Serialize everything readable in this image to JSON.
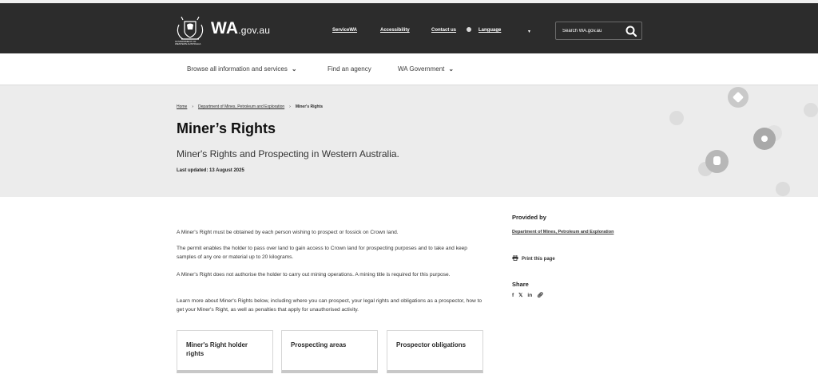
{
  "header": {
    "logo_main": "WA",
    "logo_domain": ".gov.au",
    "crest_caption": "GOVERNMENT OF WESTERN AUSTRALIA",
    "links": [
      "ServiceWA",
      "Accessibility",
      "Contact us"
    ],
    "language_label": "Language",
    "search_placeholder": "Search WA.gov.au"
  },
  "nav": {
    "items": [
      "Browse all information and services",
      "Find an agency",
      "WA Government"
    ]
  },
  "hero": {
    "breadcrumb": [
      "Home",
      "Department of Mines, Petroleum and Exploration",
      "Miner's Rights"
    ],
    "title": "Miner’s Rights",
    "subtitle": "Miner's Rights and Prospecting in Western Australia.",
    "last_updated": "Last updated: 13 August 2025"
  },
  "main": {
    "paragraphs": [
      "A Miner's Right must be obtained by each person wishing to prospect or fossick on Crown land.",
      "The permit enables the holder to pass over land to gain access to Crown land for prospecting purposes and to take and keep samples of any ore or material up to 20 kilograms.",
      "A Miner's Right does not authorise the holder to carry out mining operations. A mining title is required for this purpose.",
      "Learn more about Miner's Rights below, including where you can prospect, your legal rights and obligations as a prospector, how to get your Miner's Right, as well as penalties that apply for unauthorised activity."
    ],
    "cards": [
      "Miner's Right holder rights",
      "Prospecting areas",
      "Prospector obligations"
    ]
  },
  "sidebar": {
    "provided_by_heading": "Provided by",
    "provided_by_link": "Department of Mines, Petroleum and Exploration",
    "print_label": "Print this page",
    "share_heading": "Share",
    "share_icons": [
      "facebook-icon",
      "x-icon",
      "linkedin-icon",
      "link-icon"
    ]
  },
  "colors": {
    "header_bg": "#2c2c2c",
    "hero_bg": "#ececec",
    "text": "#1a1a1a"
  }
}
